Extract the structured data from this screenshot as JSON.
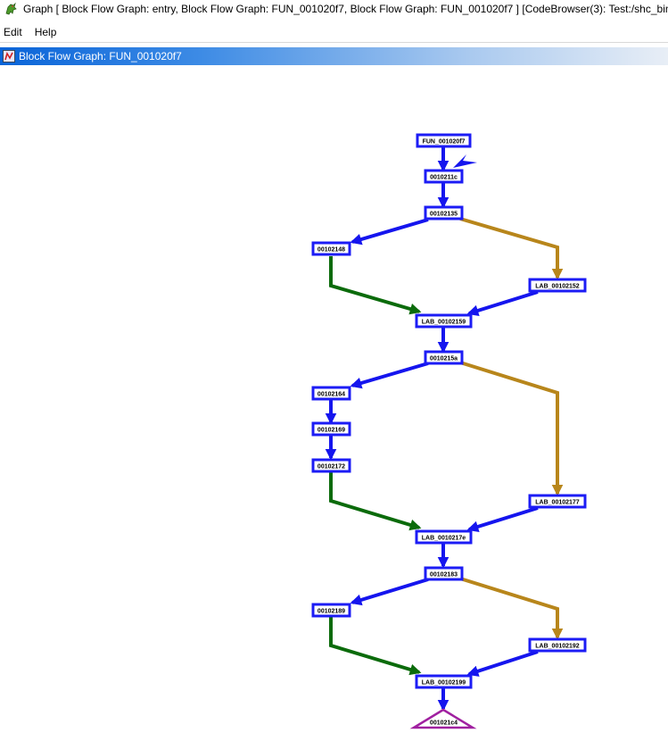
{
  "window": {
    "title": "Graph [ Block Flow Graph: entry, Block Flow Graph: FUN_001020f7, Block Flow Graph: FUN_001020f7 ] [CodeBrowser(3): Test:/shc_binary]"
  },
  "menu": {
    "items": [
      "Edit",
      "Help"
    ]
  },
  "view": {
    "title": "Block Flow Graph: FUN_001020f7"
  },
  "graph": {
    "colors": {
      "fallthrough": "#1515ee",
      "conditional_true": "#0b6b0b",
      "conditional_false": "#b8861b",
      "node_border": "#1c1cf5",
      "exit_node": "#a020a0"
    },
    "nodes": [
      {
        "id": "n0",
        "label": "FUN_001020f7"
      },
      {
        "id": "n1",
        "label": "0010211c"
      },
      {
        "id": "n2",
        "label": "00102135"
      },
      {
        "id": "n3",
        "label": "00102148"
      },
      {
        "id": "n4",
        "label": "LAB_00102152"
      },
      {
        "id": "n5",
        "label": "LAB_00102159"
      },
      {
        "id": "n6",
        "label": "0010215a"
      },
      {
        "id": "n7",
        "label": "00102164"
      },
      {
        "id": "n8",
        "label": "00102169"
      },
      {
        "id": "n9",
        "label": "00102172"
      },
      {
        "id": "n10",
        "label": "LAB_00102177"
      },
      {
        "id": "n11",
        "label": "LAB_0010217e"
      },
      {
        "id": "n12",
        "label": "00102183"
      },
      {
        "id": "n13",
        "label": "00102189"
      },
      {
        "id": "n14",
        "label": "LAB_00102192"
      },
      {
        "id": "n15",
        "label": "LAB_00102199"
      },
      {
        "id": "n16",
        "label": "001021c4"
      }
    ]
  }
}
